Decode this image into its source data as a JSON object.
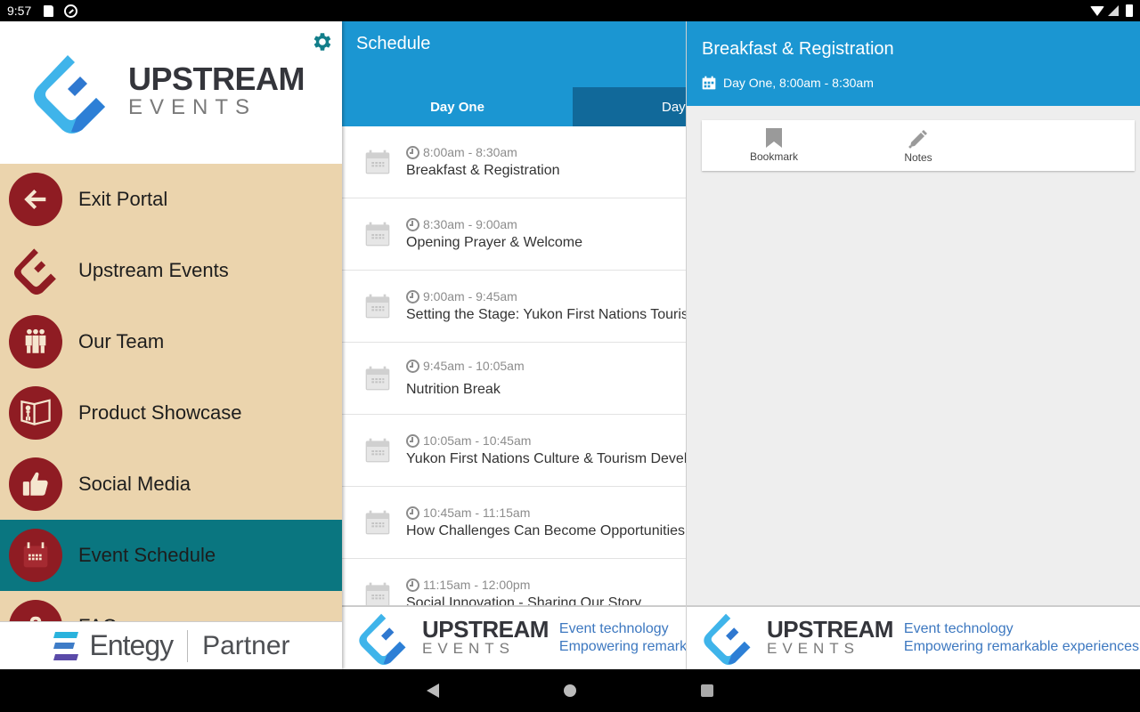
{
  "status_bar": {
    "time": "9:57"
  },
  "drawer": {
    "brand": {
      "line1": "UPSTREAM",
      "line2": "EVENTS"
    },
    "items": [
      {
        "label": "Exit Portal",
        "icon": "arrow-left-icon",
        "active": false
      },
      {
        "label": "Upstream Events",
        "icon": "upstream-logo-icon",
        "active": false
      },
      {
        "label": "Our Team",
        "icon": "team-icon",
        "active": false
      },
      {
        "label": "Product Showcase",
        "icon": "showcase-icon",
        "active": false
      },
      {
        "label": "Social Media",
        "icon": "thumbs-up-icon",
        "active": false
      },
      {
        "label": "Event Schedule",
        "icon": "calendar-icon",
        "active": true
      },
      {
        "label": "FAQ",
        "icon": "question-icon",
        "active": false
      }
    ],
    "footer": {
      "brand": "Entegy",
      "partner": "Partner"
    }
  },
  "schedule": {
    "title": "Schedule",
    "tabs": [
      {
        "label": "Day One",
        "active": true
      },
      {
        "label": "Day",
        "active": false
      }
    ],
    "sessions": [
      {
        "time": "8:00am - 8:30am",
        "title": "Breakfast & Registration"
      },
      {
        "time": "8:30am - 9:00am",
        "title": "Opening Prayer & Welcome"
      },
      {
        "time": "9:00am - 9:45am",
        "title": "Setting the Stage: Yukon First Nations Touris"
      },
      {
        "time": "9:45am - 10:05am",
        "title": "Nutrition Break"
      },
      {
        "time": "10:05am - 10:45am",
        "title": "Yukon First Nations Culture & Tourism Develo"
      },
      {
        "time": "10:45am - 11:15am",
        "title": "How Challenges Can Become Opportunities"
      },
      {
        "time": "11:15am - 12:00pm",
        "title": "Social Innovation - Sharing Our Story"
      }
    ]
  },
  "detail": {
    "title": "Breakfast & Registration",
    "subtitle": "Day One, 8:00am - 8:30am",
    "actions": [
      {
        "label": "Bookmark",
        "icon": "bookmark-icon"
      },
      {
        "label": "Notes",
        "icon": "pencil-icon"
      }
    ]
  },
  "banner": {
    "line1": "UPSTREAM",
    "line2": "EVENTS",
    "tag1": "Event technology",
    "tag2": "Empowering remarkable experiences"
  },
  "colors": {
    "primary": "#1b96d2",
    "tab_inactive": "#11699a",
    "drawer_bg": "#ebd4ad",
    "drawer_active": "#0a7680",
    "menu_icon": "#8f1c23"
  }
}
